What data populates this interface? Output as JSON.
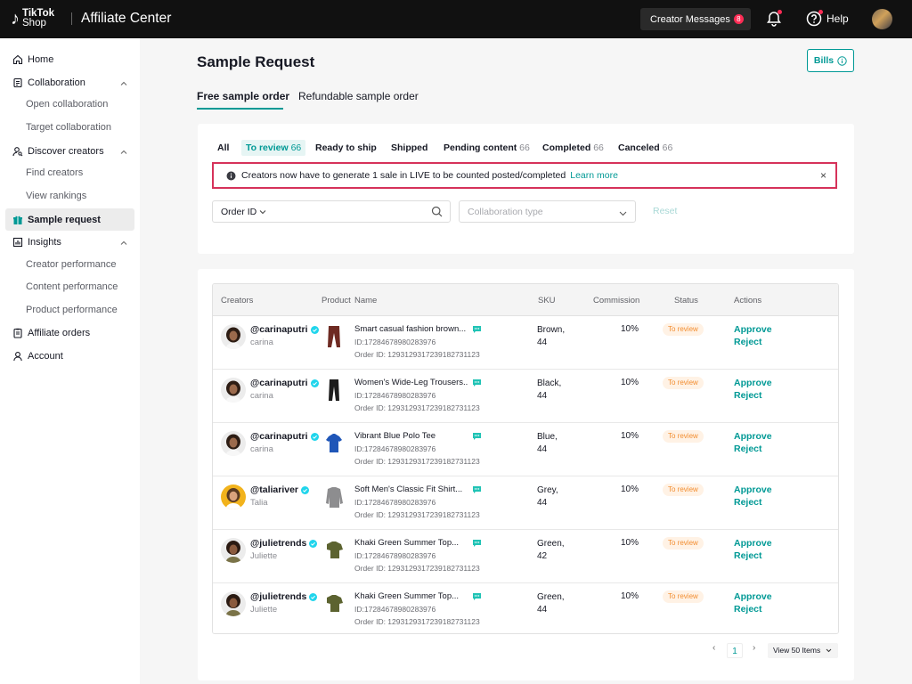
{
  "topbar": {
    "logo_line1": "TikTok",
    "logo_line2": "Shop",
    "title": "Affiliate Center",
    "creator_messages_label": "Creator Messages",
    "creator_messages_count": "8",
    "help_label": "Help"
  },
  "sidebar": {
    "items": [
      {
        "label": "Home",
        "icon": "home-icon"
      },
      {
        "label": "Collaboration",
        "icon": "collaboration-icon"
      },
      {
        "label": "Open collaboration"
      },
      {
        "label": "Target collaboration"
      },
      {
        "label": "Discover creators",
        "icon": "discover-creators-icon"
      },
      {
        "label": "Find creators"
      },
      {
        "label": "View rankings"
      },
      {
        "label": "Sample request",
        "icon": "gift-icon"
      },
      {
        "label": "Insights",
        "icon": "insights-icon"
      },
      {
        "label": "Creator performance"
      },
      {
        "label": "Content performance"
      },
      {
        "label": "Product performance"
      },
      {
        "label": "Affiliate orders",
        "icon": "orders-icon"
      },
      {
        "label": "Account",
        "icon": "account-icon"
      }
    ]
  },
  "main": {
    "title": "Sample Request",
    "bills_label": "Bills",
    "type_tabs": [
      "Free sample order",
      "Refundable sample order"
    ],
    "status_tabs": [
      {
        "label": "All",
        "count": ""
      },
      {
        "label": "To review",
        "count": "66"
      },
      {
        "label": "Ready to ship",
        "count": ""
      },
      {
        "label": "Shipped",
        "count": ""
      },
      {
        "label": "Pending content",
        "count": "66"
      },
      {
        "label": "Completed",
        "count": "66"
      },
      {
        "label": "Canceled",
        "count": "66"
      }
    ],
    "notice": {
      "text": "Creators now have to generate 1 sale in LIVE to be counted posted/completed",
      "link": "Learn more",
      "close": "×"
    },
    "filters": {
      "order_id_label": "Order ID",
      "collaboration_placeholder": "Collaboration type",
      "reset_label": "Reset"
    }
  },
  "table": {
    "columns": [
      "Creators",
      "Product",
      "Name",
      "SKU",
      "Commission",
      "Status",
      "Actions"
    ],
    "rows": [
      {
        "handle": "@carinaputri",
        "name": "carina",
        "product": "Smart casual fashion brown...",
        "pid": "ID:17284678980283976",
        "oid": "Order ID: 1293129317239182731123",
        "sku1": "Brown,",
        "sku2": "44",
        "commission": "10%",
        "status": "To review",
        "approve": "Approve",
        "reject": "Reject"
      },
      {
        "handle": "@carinaputri",
        "name": "carina",
        "product": "Women's Wide-Leg Trousers...",
        "pid": "ID:17284678980283976",
        "oid": "Order ID: 1293129317239182731123",
        "sku1": "Black,",
        "sku2": "44",
        "commission": "10%",
        "status": "To review",
        "approve": "Approve",
        "reject": "Reject"
      },
      {
        "handle": "@carinaputri",
        "name": "carina",
        "product": "Vibrant Blue Polo Tee",
        "pid": "ID:17284678980283976",
        "oid": "Order ID: 1293129317239182731123",
        "sku1": "Blue,",
        "sku2": "44",
        "commission": "10%",
        "status": "To review",
        "approve": "Approve",
        "reject": "Reject"
      },
      {
        "handle": "@taliariver",
        "name": "Talia",
        "product": "Soft Men's Classic Fit Shirt...",
        "pid": "ID:17284678980283976",
        "oid": "Order ID: 1293129317239182731123",
        "sku1": "Grey,",
        "sku2": "44",
        "commission": "10%",
        "status": "To review",
        "approve": "Approve",
        "reject": "Reject"
      },
      {
        "handle": "@julietrends",
        "name": "Juliette",
        "product": "Khaki Green Summer Top...",
        "pid": "ID:17284678980283976",
        "oid": "Order ID: 1293129317239182731123",
        "sku1": "Green,",
        "sku2": "42",
        "commission": "10%",
        "status": "To review",
        "approve": "Approve",
        "reject": "Reject"
      },
      {
        "handle": "@julietrends",
        "name": "Juliette",
        "product": "Khaki Green Summer Top...",
        "pid": "ID:17284678980283976",
        "oid": "Order ID: 1293129317239182731123",
        "sku1": "Green,",
        "sku2": "44",
        "commission": "10%",
        "status": "To review",
        "approve": "Approve",
        "reject": "Reject"
      }
    ]
  },
  "pagination": {
    "prev": "‹",
    "page": "1",
    "next": "›",
    "page_size": "View 50 Items"
  },
  "colors": {
    "accent": "#009995",
    "topbar": "#111111",
    "badge": "#fe2c55",
    "notice_border": "#d6325a",
    "status_pill_text": "#f28d30"
  }
}
